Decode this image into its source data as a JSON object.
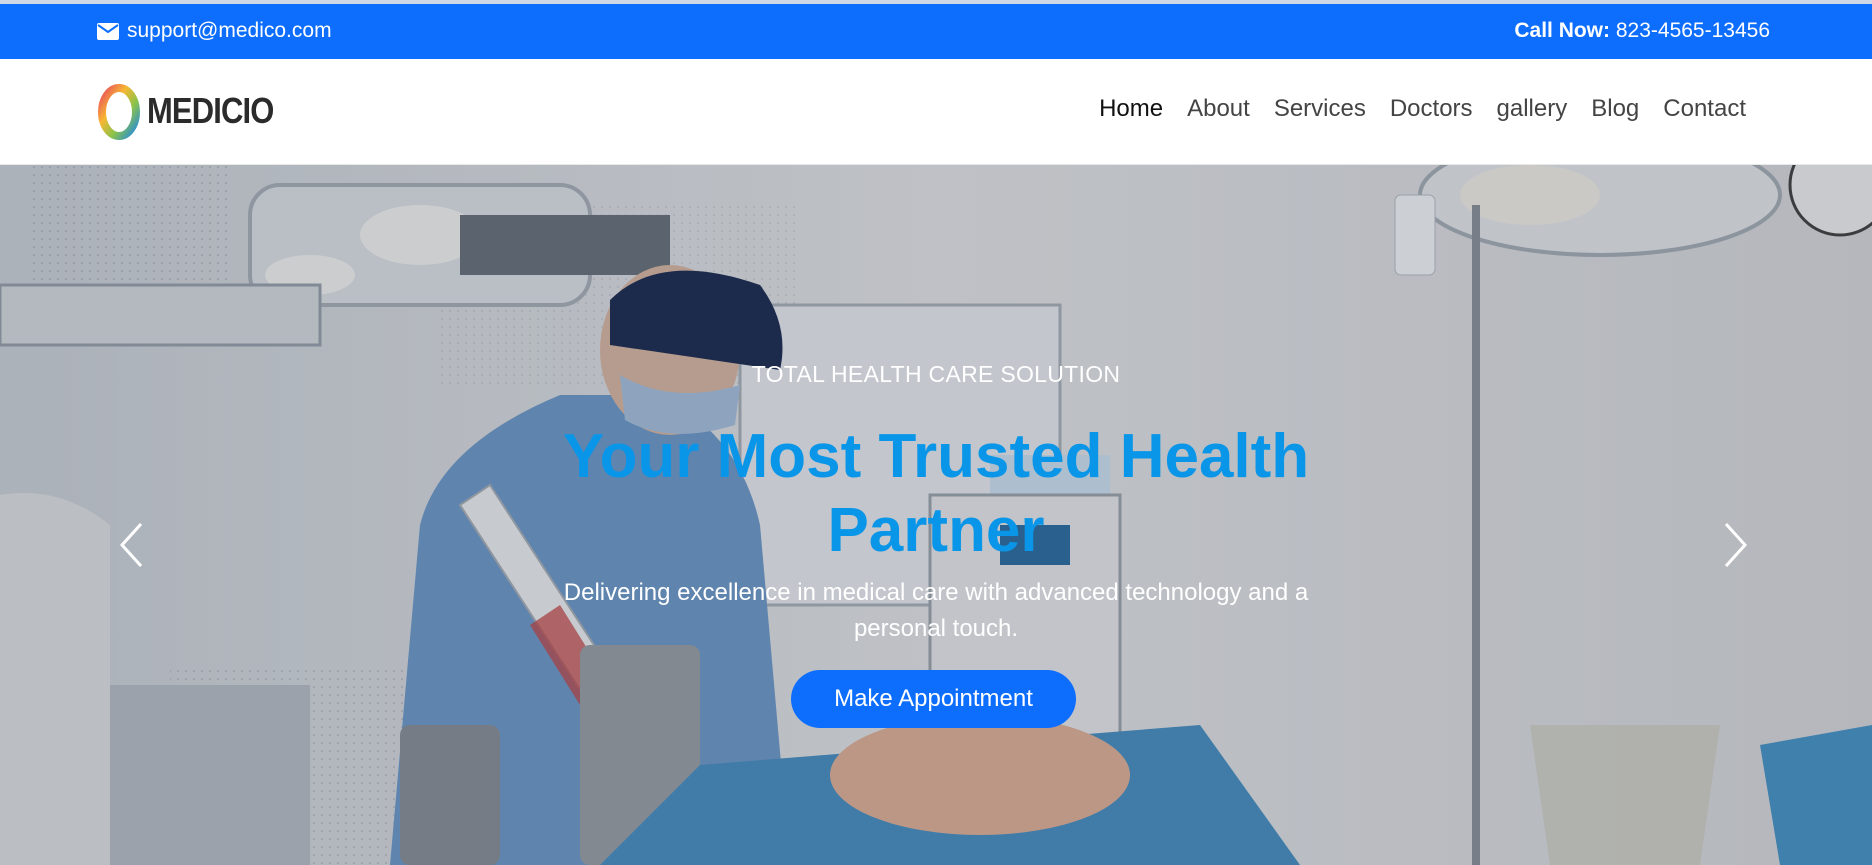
{
  "topbar": {
    "email": "support@medico.com",
    "call_label": "Call Now:",
    "call_number": "823-4565-13456"
  },
  "brand": {
    "name": "MEDICIO"
  },
  "nav": {
    "items": [
      "Home",
      "About",
      "Services",
      "Doctors",
      "gallery",
      "Blog",
      "Contact"
    ],
    "active": "Home"
  },
  "hero": {
    "subtitle": "TOTAL HEALTH CARE SOLUTION",
    "title": "Your Most Trusted Health Partner",
    "description": "Delivering excellence in medical care with advanced technology and a personal touch.",
    "cta_label": "Make Appointment"
  },
  "colors": {
    "topbar": "#0d6efd",
    "title": "#0a96e8",
    "button": "#0d6efd"
  },
  "icons": [
    "envelope-icon",
    "medicio-logo-icon",
    "chevron-left-icon",
    "chevron-right-icon"
  ]
}
